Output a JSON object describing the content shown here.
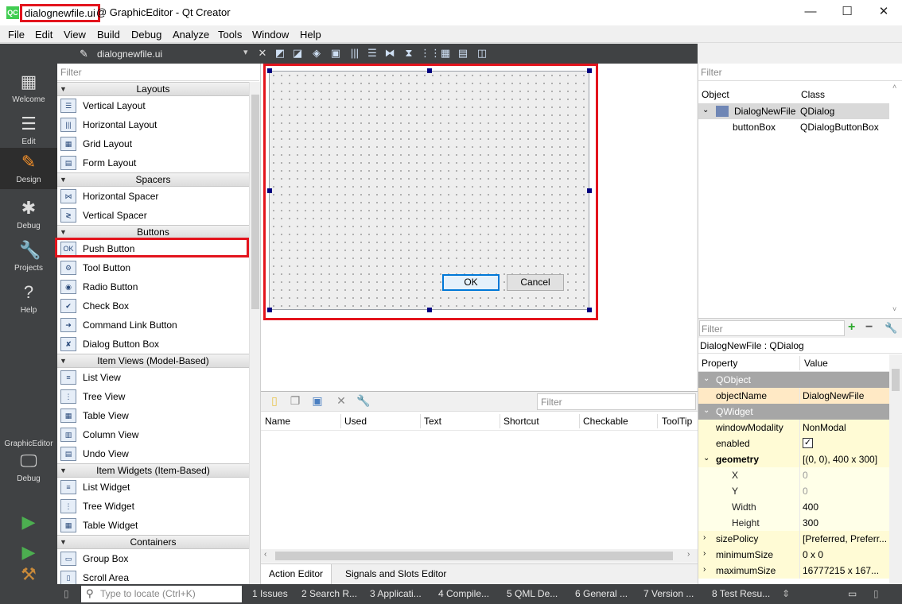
{
  "window": {
    "title_file": "dialognewfile.ui",
    "title_rest": "@ GraphicEditor - Qt Creator",
    "app_badge": "QC",
    "minimize_glyph": "—",
    "maximize_glyph": "☐",
    "close_glyph": "✕"
  },
  "menu": [
    "File",
    "Edit",
    "View",
    "Build",
    "Debug",
    "Analyze",
    "Tools",
    "Window",
    "Help"
  ],
  "modes": [
    {
      "label": "Welcome",
      "icon": "grid-icon",
      "glyph": "▦"
    },
    {
      "label": "Edit",
      "icon": "document-icon",
      "glyph": "☰"
    },
    {
      "label": "Design",
      "icon": "pencil-icon",
      "glyph": "✎"
    },
    {
      "label": "Debug",
      "icon": "bug-icon",
      "glyph": "✱"
    },
    {
      "label": "Projects",
      "icon": "wrench-icon",
      "glyph": "🔧"
    },
    {
      "label": "Help",
      "icon": "help-icon",
      "glyph": "?"
    }
  ],
  "kit": {
    "project": "GraphicEditor",
    "mode": "Debug"
  },
  "document": {
    "name": "dialognewfile.ui"
  },
  "widget_box": {
    "filter_placeholder": "Filter",
    "categories": [
      {
        "name": "Layouts",
        "items": [
          {
            "label": "Vertical Layout",
            "icon": "vertical-layout-icon",
            "glyph": "☰"
          },
          {
            "label": "Horizontal Layout",
            "icon": "horizontal-layout-icon",
            "glyph": "|||"
          },
          {
            "label": "Grid Layout",
            "icon": "grid-layout-icon",
            "glyph": "▦"
          },
          {
            "label": "Form Layout",
            "icon": "form-layout-icon",
            "glyph": "▤"
          }
        ]
      },
      {
        "name": "Spacers",
        "items": [
          {
            "label": "Horizontal Spacer",
            "icon": "horizontal-spacer-icon",
            "glyph": "⋈"
          },
          {
            "label": "Vertical Spacer",
            "icon": "vertical-spacer-icon",
            "glyph": "≷"
          }
        ]
      },
      {
        "name": "Buttons",
        "items": [
          {
            "label": "Push Button",
            "icon": "push-button-icon",
            "glyph": "OK"
          },
          {
            "label": "Tool Button",
            "icon": "tool-button-icon",
            "glyph": "⚙"
          },
          {
            "label": "Radio Button",
            "icon": "radio-button-icon",
            "glyph": "◉"
          },
          {
            "label": "Check Box",
            "icon": "check-box-icon",
            "glyph": "✔"
          },
          {
            "label": "Command Link Button",
            "icon": "command-link-icon",
            "glyph": "➜"
          },
          {
            "label": "Dialog Button Box",
            "icon": "dialog-button-box-icon",
            "glyph": "✘"
          }
        ]
      },
      {
        "name": "Item Views (Model-Based)",
        "items": [
          {
            "label": "List View",
            "icon": "list-view-icon",
            "glyph": "≡"
          },
          {
            "label": "Tree View",
            "icon": "tree-view-icon",
            "glyph": "⋮"
          },
          {
            "label": "Table View",
            "icon": "table-view-icon",
            "glyph": "▦"
          },
          {
            "label": "Column View",
            "icon": "column-view-icon",
            "glyph": "▥"
          },
          {
            "label": "Undo View",
            "icon": "undo-view-icon",
            "glyph": "▤"
          }
        ]
      },
      {
        "name": "Item Widgets (Item-Based)",
        "items": [
          {
            "label": "List Widget",
            "icon": "list-widget-icon",
            "glyph": "≡"
          },
          {
            "label": "Tree Widget",
            "icon": "tree-widget-icon",
            "glyph": "⋮"
          },
          {
            "label": "Table Widget",
            "icon": "table-widget-icon",
            "glyph": "▦"
          }
        ]
      },
      {
        "name": "Containers",
        "items": [
          {
            "label": "Group Box",
            "icon": "group-box-icon",
            "glyph": "▭"
          },
          {
            "label": "Scroll Area",
            "icon": "scroll-area-icon",
            "glyph": "▯"
          }
        ]
      }
    ]
  },
  "form": {
    "ok_label": "OK",
    "cancel_label": "Cancel"
  },
  "action_editor": {
    "filter_placeholder": "Filter",
    "columns": [
      "Name",
      "Used",
      "Text",
      "Shortcut",
      "Checkable",
      "ToolTip"
    ],
    "tabs": [
      "Action Editor",
      "Signals and Slots Editor"
    ]
  },
  "object_inspector": {
    "filter_placeholder": "Filter",
    "columns": [
      "Object",
      "Class"
    ],
    "rows": [
      {
        "object": "DialogNewFile",
        "class": "QDialog"
      },
      {
        "object": "buttonBox",
        "class": "QDialogButtonBox"
      }
    ]
  },
  "property_editor": {
    "filter_placeholder": "Filter",
    "title": "DialogNewFile : QDialog",
    "columns": [
      "Property",
      "Value"
    ],
    "rows": [
      {
        "name": "QObject",
        "value": "",
        "kind": "group",
        "caret": "⌄"
      },
      {
        "name": "objectName",
        "value": "DialogNewFile",
        "kind": "oname"
      },
      {
        "name": "QWidget",
        "value": "",
        "kind": "group",
        "caret": "⌄"
      },
      {
        "name": "windowModality",
        "value": "NonModal",
        "kind": "yel"
      },
      {
        "name": "enabled",
        "value": "",
        "kind": "yel",
        "checked": true
      },
      {
        "name": "geometry",
        "value": "[(0, 0), 400 x 300]",
        "kind": "yel bold",
        "caret": "⌄"
      },
      {
        "name": "X",
        "value": "0",
        "kind": "yel2 sub dim"
      },
      {
        "name": "Y",
        "value": "0",
        "kind": "yel2 sub dim"
      },
      {
        "name": "Width",
        "value": "400",
        "kind": "yel2 sub"
      },
      {
        "name": "Height",
        "value": "300",
        "kind": "yel2 sub"
      },
      {
        "name": "sizePolicy",
        "value": "[Preferred, Preferr...",
        "kind": "yel",
        "caret": "›"
      },
      {
        "name": "minimumSize",
        "value": "0 x 0",
        "kind": "yel",
        "caret": "›"
      },
      {
        "name": "maximumSize",
        "value": "16777215 x 167...",
        "kind": "yel",
        "caret": "›"
      }
    ]
  },
  "statusbar": {
    "locator_placeholder": "Type to locate (Ctrl+K)",
    "panes": [
      "1  Issues",
      "2  Search R...",
      "3  Applicati...",
      "4  Compile...",
      "5  QML De...",
      "6  General ...",
      "7  Version ...",
      "8  Test Resu..."
    ]
  },
  "colors": {
    "highlight": "#e3141d",
    "mode_bar": "#404244",
    "design_accent": "#f7922a"
  }
}
